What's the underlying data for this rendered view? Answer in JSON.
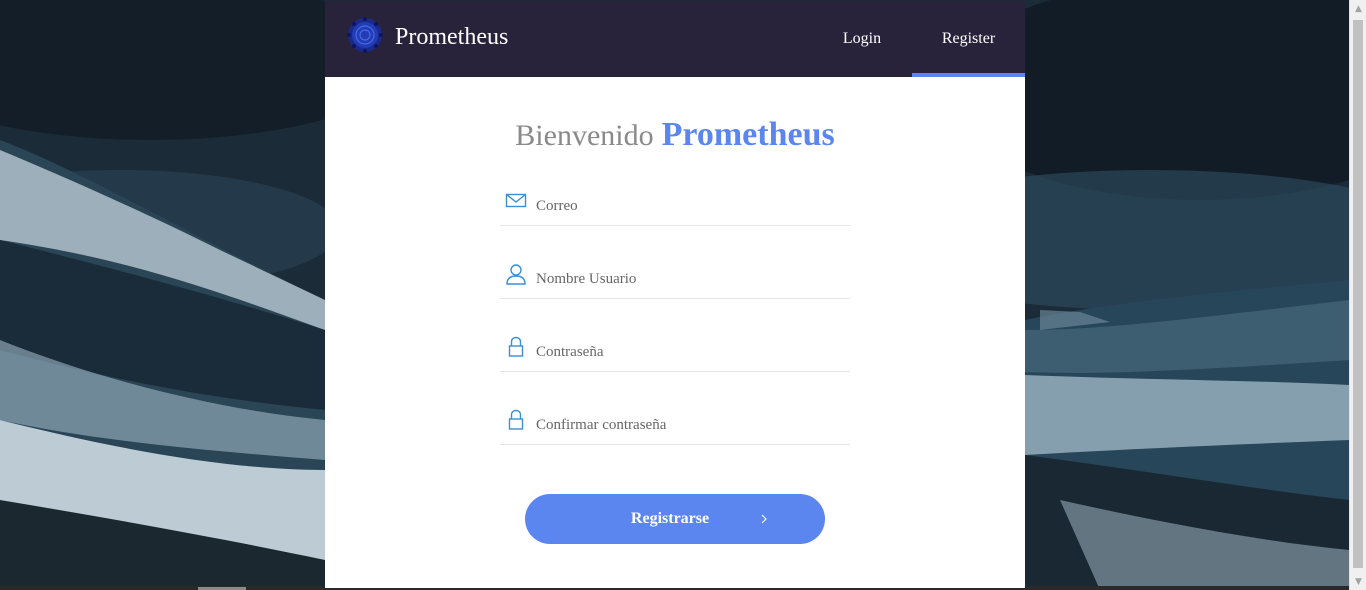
{
  "brand": {
    "name": "Prometheus"
  },
  "nav": {
    "login_label": "Login",
    "register_label": "Register",
    "active": "Register"
  },
  "welcome": {
    "prefix": "Bienvenido",
    "highlight": "Prometheus"
  },
  "form": {
    "email_placeholder": "Correo",
    "username_placeholder": "Nombre Usuario",
    "password_placeholder": "Contraseña",
    "confirm_placeholder": "Confirmar contraseña",
    "submit_label": "Registrarse"
  },
  "icons": {
    "logo": "prometheus-logo-icon",
    "email": "envelope-icon",
    "user": "user-icon",
    "password": "lock-icon",
    "confirm": "lock-icon",
    "submit": "chevron-right-icon"
  },
  "colors": {
    "navbar": "#28233a",
    "accent": "#5b86f0",
    "icon": "#3a8fd6",
    "muted_text": "#8a8a8a"
  }
}
